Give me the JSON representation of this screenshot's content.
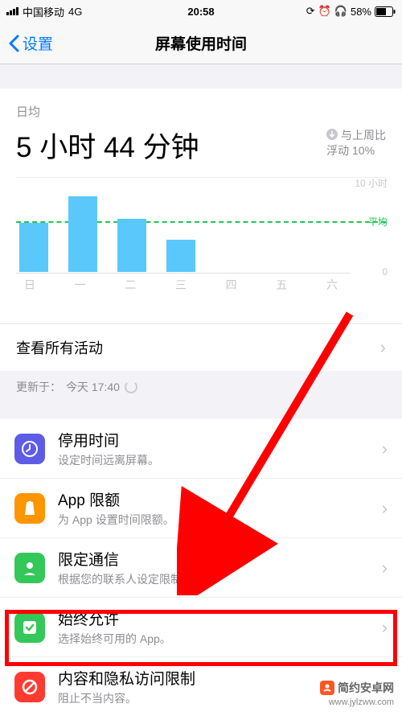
{
  "status": {
    "carrier": "中国移动",
    "network": "4G",
    "time": "20:58",
    "battery": "58%"
  },
  "nav": {
    "back": "设置",
    "title": "屏幕使用时间"
  },
  "daily": {
    "label": "日均",
    "time": "5 小时 44 分钟",
    "change_line1": "与上周比",
    "change_line2": "浮动 10%"
  },
  "chart_data": {
    "type": "bar",
    "categories": [
      "日",
      "一",
      "二",
      "三",
      "四",
      "五",
      "六"
    ],
    "values": [
      5.2,
      8.0,
      5.6,
      3.4,
      0,
      0,
      0
    ],
    "ylim": [
      0,
      10
    ],
    "ylabel_top": "10 小时",
    "ylabel_bottom": "0",
    "avg_label": "平均",
    "avg_value": 5.7
  },
  "activity": {
    "label": "查看所有活动"
  },
  "updated": {
    "prefix": "更新于：",
    "time": "今天 17:40"
  },
  "settings": [
    {
      "title": "停用时间",
      "sub": "设定时间远离屏幕。",
      "color": "#5e5ce6"
    },
    {
      "title": "App 限额",
      "sub": "为 App 设置时间限额。",
      "color": "#ff9500"
    },
    {
      "title": "限定通信",
      "sub": "根据您的联系人设定限制。",
      "color": "#34c759"
    },
    {
      "title": "始终允许",
      "sub": "选择始终可用的 App。",
      "color": "#34c759"
    },
    {
      "title": "内容和隐私访问限制",
      "sub": "阻止不当内容。",
      "color": "#ff3b30"
    }
  ],
  "watermark": {
    "title": "简约安卓网",
    "url": "www.jylzww.com"
  }
}
